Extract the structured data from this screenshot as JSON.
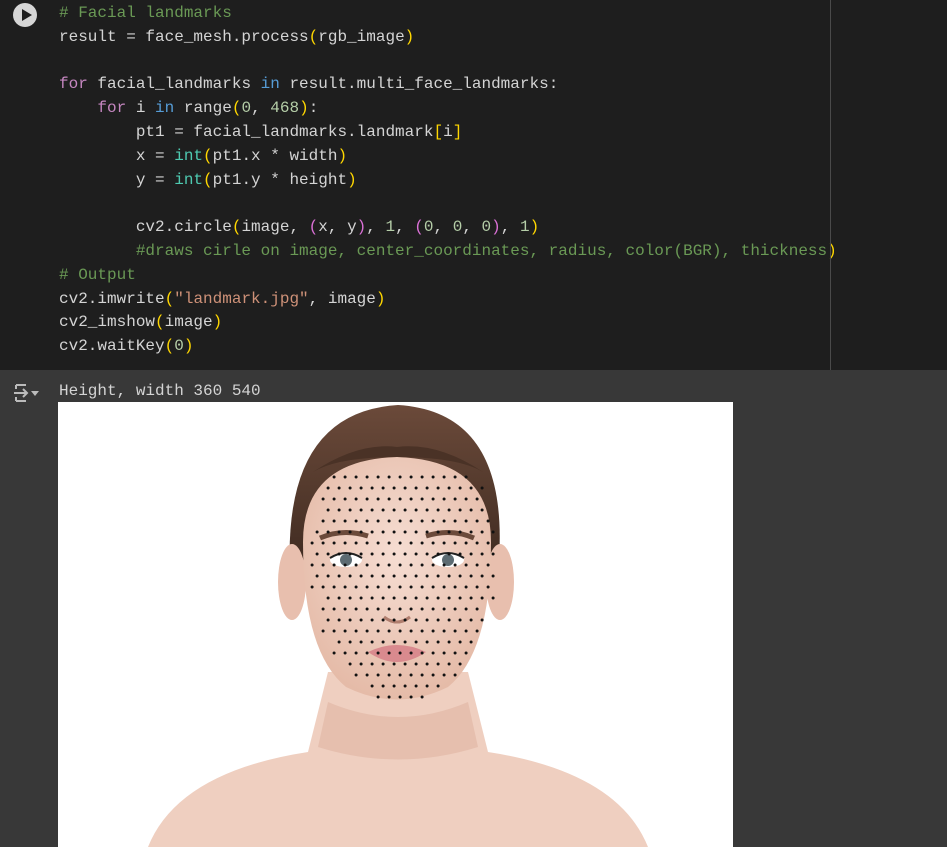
{
  "cell": {
    "run_button": "play-icon",
    "code_lines": [
      [
        [
          "# Facial landmarks",
          "com"
        ]
      ],
      [
        [
          "result = face_mesh.process",
          "txt"
        ],
        [
          "(",
          "p1"
        ],
        [
          "rgb_image",
          "txt"
        ],
        [
          ")",
          "p1"
        ]
      ],
      [],
      [
        [
          "for",
          "kw"
        ],
        [
          " facial_landmarks ",
          "txt"
        ],
        [
          "in",
          "in"
        ],
        [
          " result.multi_face_landmarks:",
          "txt"
        ]
      ],
      [
        [
          "    ",
          "txt"
        ],
        [
          "for",
          "kw"
        ],
        [
          " i ",
          "txt"
        ],
        [
          "in",
          "in"
        ],
        [
          " ",
          "txt"
        ],
        [
          "range",
          "txt"
        ],
        [
          "(",
          "p1"
        ],
        [
          "0",
          "num"
        ],
        [
          ", ",
          "txt"
        ],
        [
          "468",
          "num"
        ],
        [
          ")",
          "p1"
        ],
        [
          ":",
          "txt"
        ]
      ],
      [
        [
          "        pt1 = facial_landmarks.landmark",
          "txt"
        ],
        [
          "[",
          "p1"
        ],
        [
          "i",
          "txt"
        ],
        [
          "]",
          "p1"
        ]
      ],
      [
        [
          "        x = ",
          "txt"
        ],
        [
          "int",
          "bi"
        ],
        [
          "(",
          "p1"
        ],
        [
          "pt1.x * width",
          "txt"
        ],
        [
          ")",
          "p1"
        ]
      ],
      [
        [
          "        y = ",
          "txt"
        ],
        [
          "int",
          "bi"
        ],
        [
          "(",
          "p1"
        ],
        [
          "pt1.y * height",
          "txt"
        ],
        [
          ")",
          "p1"
        ]
      ],
      [],
      [
        [
          "        cv2.circle",
          "txt"
        ],
        [
          "(",
          "p1"
        ],
        [
          "image, ",
          "txt"
        ],
        [
          "(",
          "p2"
        ],
        [
          "x, y",
          "txt"
        ],
        [
          ")",
          "p2"
        ],
        [
          ", ",
          "txt"
        ],
        [
          "1",
          "num"
        ],
        [
          ", ",
          "txt"
        ],
        [
          "(",
          "p2"
        ],
        [
          "0",
          "num"
        ],
        [
          ", ",
          "txt"
        ],
        [
          "0",
          "num"
        ],
        [
          ", ",
          "txt"
        ],
        [
          "0",
          "num"
        ],
        [
          ")",
          "p2"
        ],
        [
          ", ",
          "txt"
        ],
        [
          "1",
          "num"
        ],
        [
          ")",
          "p1"
        ]
      ],
      [
        [
          "        #draws cirle on image, center_coordinates, radius, color(BGR), thickness",
          "com"
        ],
        [
          ")",
          "p1"
        ]
      ],
      [
        [
          "# Output",
          "com"
        ]
      ],
      [
        [
          "cv2.imwrite",
          "txt"
        ],
        [
          "(",
          "p1"
        ],
        [
          "\"landmark.jpg\"",
          "str"
        ],
        [
          ", image",
          "txt"
        ],
        [
          ")",
          "p1"
        ]
      ],
      [
        [
          "cv2_imshow",
          "txt"
        ],
        [
          "(",
          "p1"
        ],
        [
          "image",
          "txt"
        ],
        [
          ")",
          "p1"
        ]
      ],
      [
        [
          "cv2.waitKey",
          "txt"
        ],
        [
          "(",
          "p1"
        ],
        [
          "0",
          "num"
        ],
        [
          ")",
          "p1"
        ]
      ]
    ]
  },
  "output": {
    "icon": "output-collapse-icon",
    "text": "Height, width 360 540",
    "image": "face-landmarks-image"
  },
  "colors": {
    "cell_bg": "#1e1e1e",
    "output_bg": "#383838",
    "comment": "#6a9955",
    "keyword": "#c586c0",
    "string": "#ce9178"
  }
}
